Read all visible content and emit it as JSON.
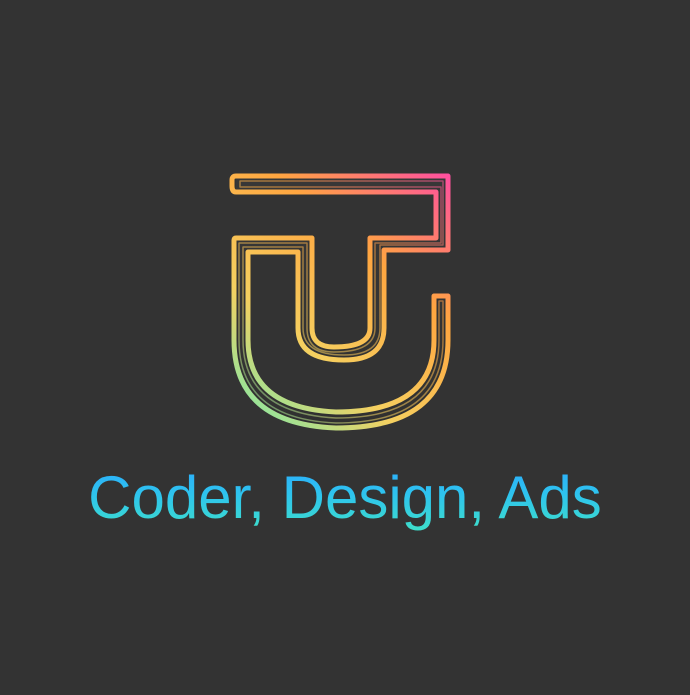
{
  "logo": {
    "icon": "tu-monogram-icon",
    "gradient": {
      "pink": "#ff4fa0",
      "orange": "#ffa640",
      "yellow": "#f5d060",
      "green": "#7fe8a8"
    }
  },
  "tagline": {
    "text": "Coder, Design, Ads",
    "colors": [
      "#2ba8ff",
      "#3fe0c7"
    ]
  },
  "background": "#333333"
}
